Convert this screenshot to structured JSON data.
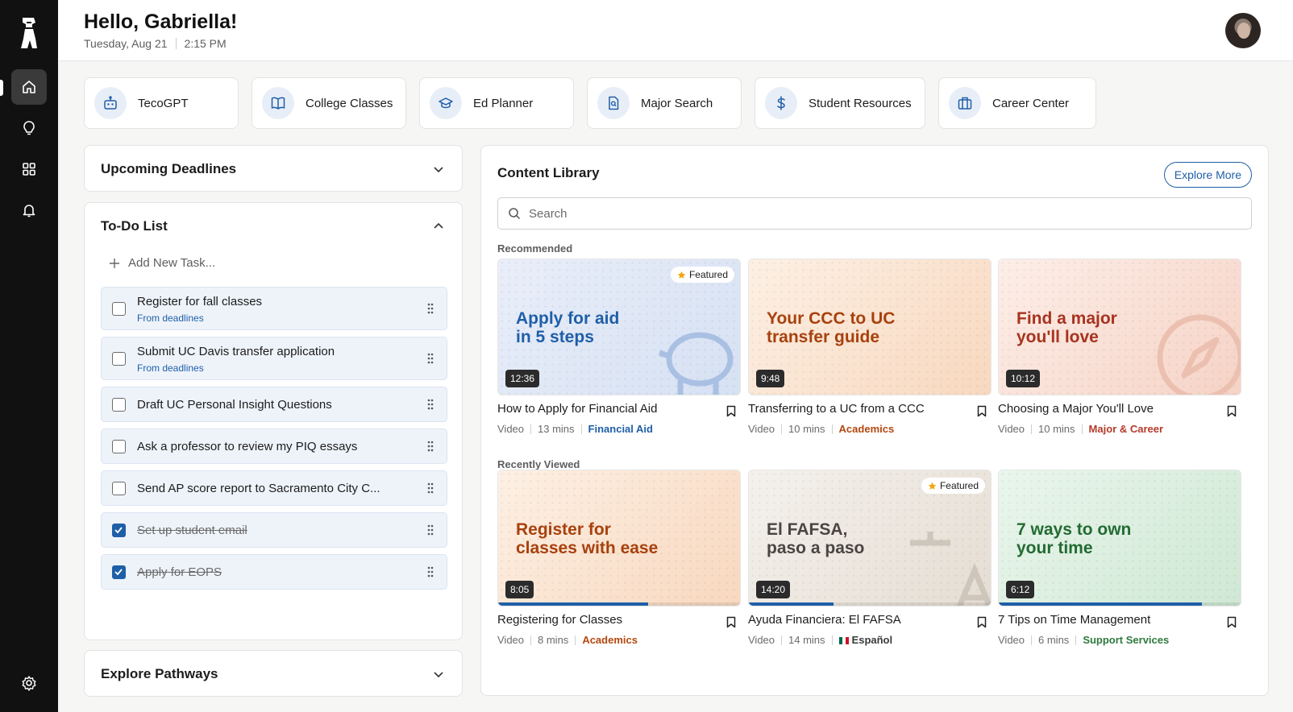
{
  "header": {
    "greeting": "Hello, Gabriella!",
    "date": "Tuesday, Aug 21",
    "time": "2:15 PM"
  },
  "rail": {
    "items": [
      {
        "icon": "home-icon"
      },
      {
        "icon": "lightbulb-icon"
      },
      {
        "icon": "grid-icon"
      },
      {
        "icon": "bell-icon"
      },
      {
        "icon": "settings-icon"
      }
    ]
  },
  "quick_links": [
    {
      "label": "TecoGPT",
      "icon": "robot-icon"
    },
    {
      "label": "College Classes",
      "icon": "book-open-icon"
    },
    {
      "label": "Ed Planner",
      "icon": "graduation-cap-icon"
    },
    {
      "label": "Major Search",
      "icon": "document-search-icon"
    },
    {
      "label": "Student Resources",
      "icon": "dollar-icon"
    },
    {
      "label": "Career Center",
      "icon": "briefcase-icon"
    }
  ],
  "deadlines": {
    "title": "Upcoming Deadlines"
  },
  "todo": {
    "title": "To-Do List",
    "add_placeholder": "Add New Task...",
    "tasks": [
      {
        "label": "Register for fall classes",
        "source": "From deadlines",
        "done": false
      },
      {
        "label": "Submit UC Davis transfer application",
        "source": "From deadlines",
        "done": false
      },
      {
        "label": "Draft UC Personal Insight Questions",
        "source": "",
        "done": false
      },
      {
        "label": "Ask a professor to review my PIQ essays",
        "source": "",
        "done": false
      },
      {
        "label": "Send AP score report to Sacramento City C...",
        "source": "",
        "done": false
      },
      {
        "label": "Set up student email",
        "source": "",
        "done": true
      },
      {
        "label": "Apply for EOPS",
        "source": "",
        "done": true
      }
    ]
  },
  "pathways": {
    "title": "Explore Pathways"
  },
  "library": {
    "title": "Content Library",
    "explore_label": "Explore More",
    "search_placeholder": "Search",
    "recommended_label": "Recommended",
    "recent_label": "Recently Viewed",
    "featured_label": "Featured",
    "recommended": [
      {
        "headline": "Apply for aid\nin 5 steps",
        "duration": "12:36",
        "featured": true,
        "title": "How to Apply for Financial Aid",
        "type": "Video",
        "length": "13 mins",
        "category": "Financial Aid",
        "category_color": "#1f5fa8",
        "theme": "blue",
        "art": "piggy-bank-icon"
      },
      {
        "headline": "Your CCC to UC\ntransfer guide",
        "duration": "9:48",
        "featured": false,
        "title": "Transferring to a UC from a CCC",
        "type": "Video",
        "length": "10 mins",
        "category": "Academics",
        "category_color": "#b5470f",
        "theme": "orange",
        "art": "book-icon"
      },
      {
        "headline": "Find a major\nyou'll love",
        "duration": "10:12",
        "featured": false,
        "title": "Choosing a Major You'll Love",
        "type": "Video",
        "length": "10 mins",
        "category": "Major & Career",
        "category_color": "#b53a2a",
        "theme": "red",
        "art": "compass-icon"
      }
    ],
    "recent": [
      {
        "headline": "Register for\nclasses with ease",
        "duration": "8:05",
        "featured": false,
        "progress": 0.62,
        "title": "Registering for Classes",
        "type": "Video",
        "length": "8 mins",
        "category": "Academics",
        "category_color": "#b5470f",
        "theme": "orange",
        "art": "book-icon"
      },
      {
        "headline": "El FAFSA,\npaso a paso",
        "duration": "14:20",
        "featured": true,
        "progress": 0.35,
        "title": "Ayuda Financiera: El FAFSA",
        "type": "Video",
        "length": "14 mins",
        "category": "Español",
        "category_color": "#3a3a3a",
        "theme": "gray",
        "art": "translate-icon",
        "flag": true
      },
      {
        "headline": "7 ways to own\nyour time",
        "duration": "6:12",
        "featured": false,
        "progress": 0.84,
        "title": "7 Tips on Time Management",
        "type": "Video",
        "length": "6 mins",
        "category": "Support Services",
        "category_color": "#2e7a3d",
        "theme": "green",
        "art": "heart-hands-icon"
      }
    ]
  },
  "colors": {
    "accent": "#1f5fa8",
    "rail": "#111111"
  }
}
